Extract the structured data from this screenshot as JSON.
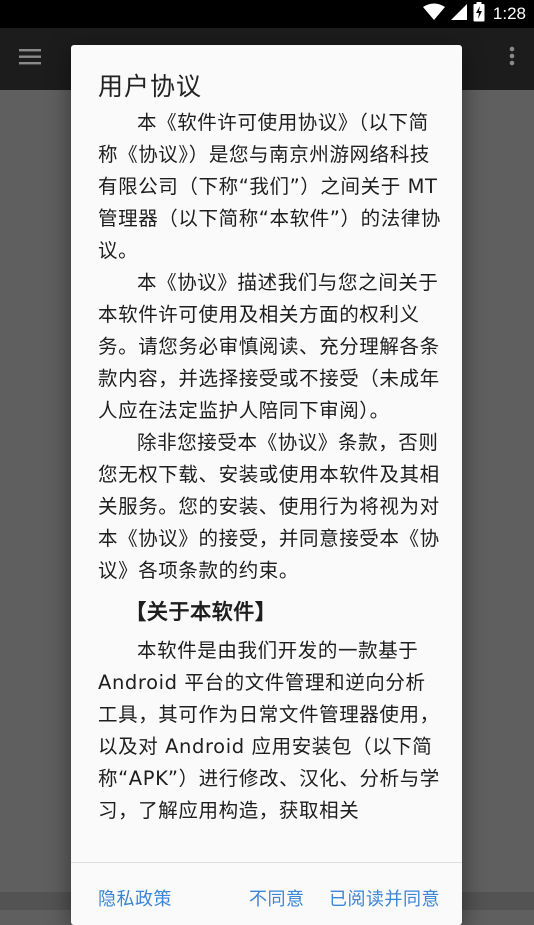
{
  "status_bar": {
    "time": "1:28",
    "icons": [
      "wifi-icon",
      "signal-icon",
      "battery-charging-icon"
    ]
  },
  "app_bar": {
    "icons": [
      "hamburger-menu-icon",
      "more-vert-icon"
    ]
  },
  "dialog": {
    "title": "用户协议",
    "paragraphs": [
      "本《软件许可使用协议》（以下简称《协议》）是您与南京州游网络科技有限公司（下称“我们”）之间关于 MT 管理器（以下简称“本软件”）的法律协议。",
      "本《协议》描述我们与您之间关于本软件许可使用及相关方面的权利义务。请您务必审慎阅读、充分理解各条款内容，并选择接受或不接受（未成年人应在法定监护人陪同下审阅）。",
      "除非您接受本《协议》条款，否则您无权下载、安装或使用本软件及其相关服务。您的安装、使用行为将视为对本《协议》的接受，并同意接受本《协议》各项条款的约束。"
    ],
    "section_heading": "【关于本软件】",
    "section_paragraph": "本软件是由我们开发的一款基于 Android 平台的文件管理和逆向分析工具，其可作为日常文件管理器使用，以及对 Android 应用安装包（以下简称“APK”）进行修改、汉化、分析与学习，了解应用构造，获取相关",
    "buttons": {
      "privacy": "隐私政策",
      "disagree": "不同意",
      "agree": "已阅读并同意"
    }
  },
  "colors": {
    "accent": "#3b86d6",
    "app_bar": "#1c1c1c",
    "scrim": "#5f5f5f",
    "dialog_bg": "#fafafa"
  }
}
